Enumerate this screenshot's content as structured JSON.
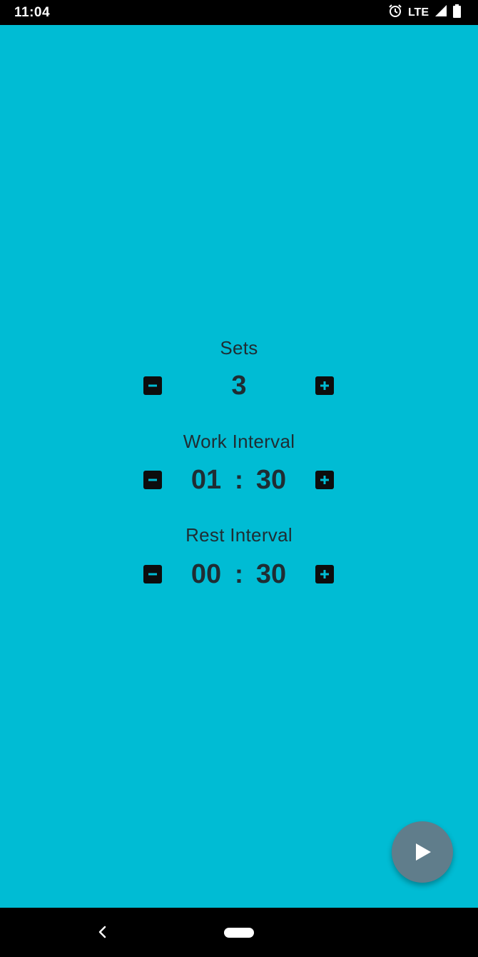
{
  "status_bar": {
    "time": "11:04",
    "network": "LTE",
    "icons": [
      "alarm-icon",
      "signal-icon",
      "battery-icon"
    ]
  },
  "colors": {
    "background": "#00bcd4",
    "fab": "#607d8b",
    "text": "#1f2d33"
  },
  "sets": {
    "label": "Sets",
    "value": "3"
  },
  "work_interval": {
    "label": "Work Interval",
    "minutes": "01",
    "separator": ":",
    "seconds": "30"
  },
  "rest_interval": {
    "label": "Rest Interval",
    "minutes": "00",
    "separator": ":",
    "seconds": "30"
  },
  "fab": {
    "icon": "play-icon"
  },
  "nav": {
    "icons": [
      "back-icon",
      "home-pill-icon"
    ]
  }
}
